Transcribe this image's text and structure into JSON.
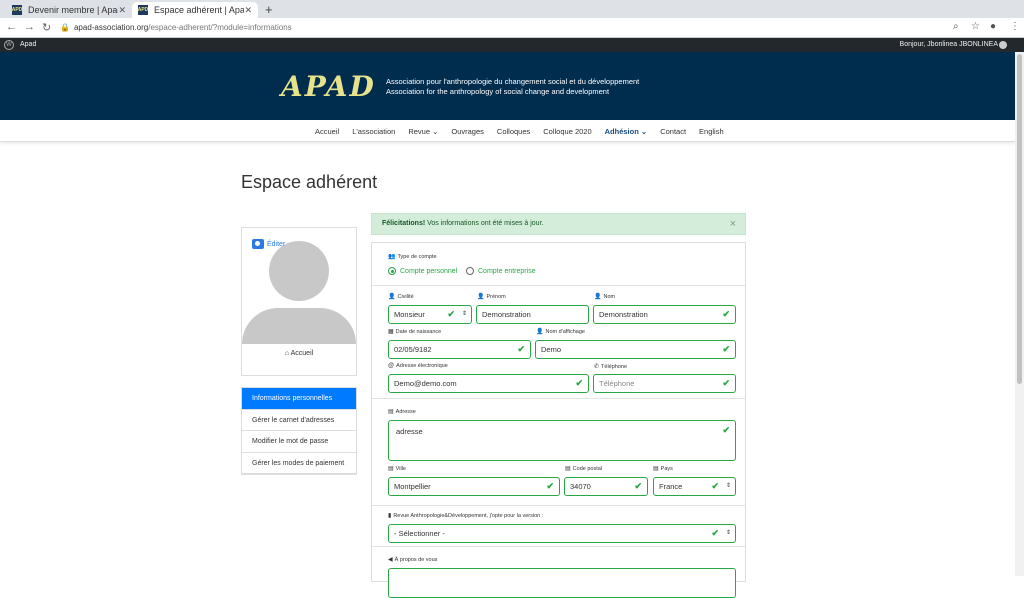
{
  "browser": {
    "tabs": [
      {
        "title": "Devenir membre | Apad",
        "favicon": "APD"
      },
      {
        "title": "Espace adhérent | Apad",
        "favicon": "APD"
      }
    ],
    "url_domain": "apad-association.org",
    "url_path": "/espace-adherent/?module=informations"
  },
  "wpbar": {
    "site": "Apad",
    "greeting": "Bonjour, Jbonlinea JBONLINEA"
  },
  "banner": {
    "logo": "APAD",
    "tagline_fr": "Association pour l'anthropologie du changement social et du développement",
    "tagline_en": "Association for the anthropology of social change and development"
  },
  "menu": {
    "items": [
      "Accueil",
      "L'association",
      "Revue ⌄",
      "Ouvrages",
      "Colloques",
      "Colloque 2020",
      "Adhésion ⌄",
      "Contact",
      "English"
    ],
    "active_index": 6
  },
  "page": {
    "title": "Espace adhérent"
  },
  "profile": {
    "edit_label": "Éditer",
    "home_label": "Accueil"
  },
  "sidemenu": {
    "items": [
      "Informations personnelles",
      "Gérer le carnet d'adresses",
      "Modifier le mot de passe",
      "Gérer les modes de paiement"
    ],
    "active_index": 0
  },
  "alert": {
    "strong": "Félicitations!",
    "text": " Vos informations ont été mises à jour.",
    "close": "×"
  },
  "form": {
    "account_type_label": "Type de compte",
    "account_options": [
      "Compte personnel",
      "Compte entreprise"
    ],
    "civility_label": "Civilité",
    "civility_value": "Monsieur",
    "firstname_label": "Prénom",
    "firstname_value": "Demonstration",
    "lastname_label": "Nom",
    "lastname_value": "Demonstration",
    "birthdate_label": "Date de naissance",
    "birthdate_value": "02/05/9182",
    "display_name_label": "Nom d'affichage",
    "display_name_value": "Demo",
    "email_label": "Adresse électronique",
    "email_value": "Demo@demo.com",
    "phone_label": "Téléphone",
    "phone_placeholder": "Téléphone",
    "address_label": "Adresse",
    "address_value": "adresse",
    "city_label": "Ville",
    "city_value": "Montpellier",
    "postcode_label": "Code postal",
    "postcode_value": "34070",
    "country_label": "Pays",
    "country_value": "France",
    "journal_label": "Revue Anthropologie&Développement, j'opte pour la version :",
    "journal_value": "- Sélectionner -",
    "about_label": "À propos de vous"
  },
  "colors": {
    "banner": "#002d4e",
    "accent": "#007bff",
    "valid": "#28a745",
    "logo": "#e6e38c"
  }
}
